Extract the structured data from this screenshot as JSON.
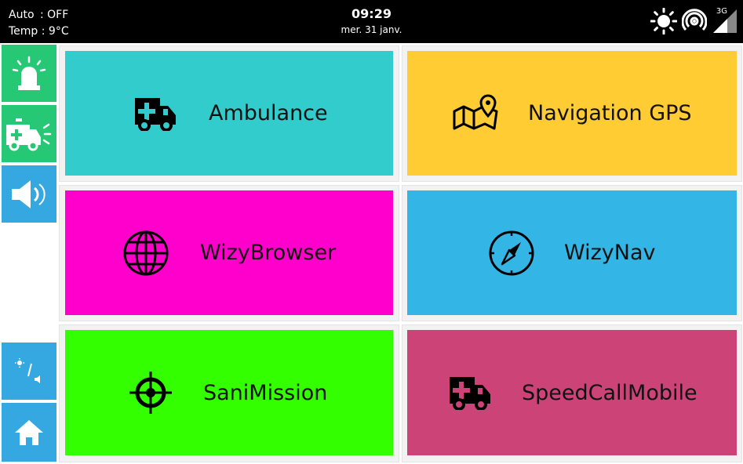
{
  "status": {
    "auto_label": "Auto",
    "auto_value": ": OFF",
    "temp_label": "Temp",
    "temp_value": ": 9°C",
    "time": "09:29",
    "date": "mer. 31 janv.",
    "network": "3G"
  },
  "sidebar": [
    {
      "name": "siren",
      "icon": "siren-icon"
    },
    {
      "name": "ambulance-lights",
      "icon": "ambulance-lights-icon"
    },
    {
      "name": "speaker",
      "icon": "speaker-icon"
    },
    {
      "name": "brightness-volume",
      "icon": "brightness-volume-icon"
    },
    {
      "name": "home",
      "icon": "home-icon"
    }
  ],
  "tiles": [
    {
      "label": "Ambulance",
      "icon": "ambulance-icon",
      "color": "#33cccc"
    },
    {
      "label": "Navigation GPS",
      "icon": "map-pin-icon",
      "color": "#ffcc33"
    },
    {
      "label": "WizyBrowser",
      "icon": "globe-icon",
      "color": "#ff00cc"
    },
    {
      "label": "WizyNav",
      "icon": "compass-icon",
      "color": "#33b5e5"
    },
    {
      "label": "SaniMission",
      "icon": "crosshair-icon",
      "color": "#33ff00"
    },
    {
      "label": "SpeedCallMobile",
      "icon": "ambulance-icon",
      "color": "#cc4477"
    }
  ]
}
